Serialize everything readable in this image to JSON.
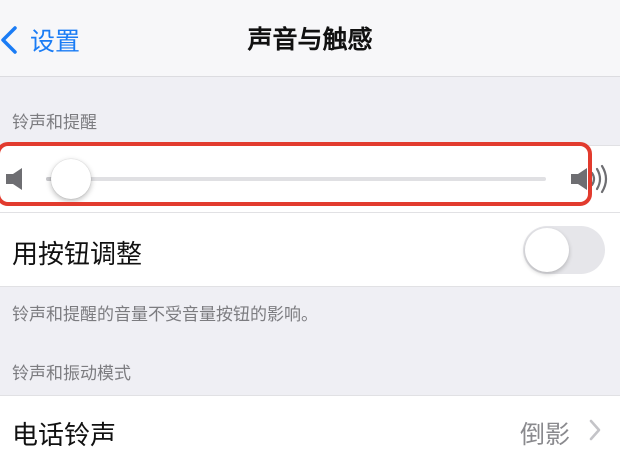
{
  "navbar": {
    "back_label": "设置",
    "title": "声音与触感"
  },
  "sections": {
    "ringer_header": "铃声和提醒",
    "vibration_header": "铃声和振动模式"
  },
  "ringer": {
    "volume_level": 0.05,
    "change_with_buttons_label": "用按钮调整",
    "change_with_buttons_on": false,
    "footer_note": "铃声和提醒的音量不受音量按钮的影响。"
  },
  "ringtone": {
    "label": "电话铃声",
    "value": "倒影"
  },
  "colors": {
    "accent": "#1a7cf5",
    "highlight": "#e23b2e"
  },
  "icons": {
    "back": "chevron-left-icon",
    "volume_low": "speaker-low-icon",
    "volume_high": "speaker-high-icon",
    "disclosure": "chevron-right-icon"
  }
}
